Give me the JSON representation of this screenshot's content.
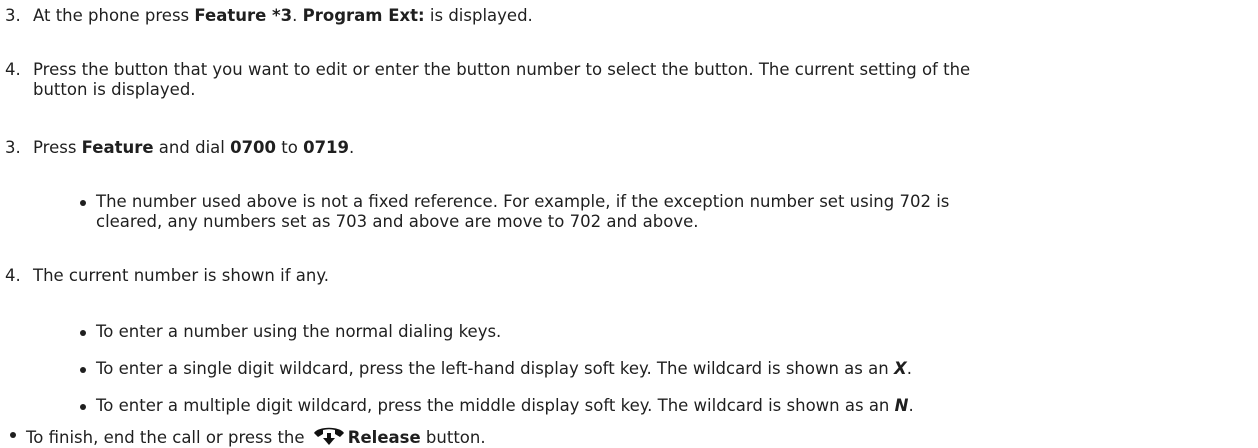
{
  "steps": [
    {
      "num": "3.",
      "prefix": "At the phone press ",
      "bold1": "Feature *3",
      "mid": ". ",
      "bold2": "Program Ext:",
      "suffix": " is displayed."
    },
    {
      "num": "4.",
      "line1": "Press the button that you want to edit or enter the button number to select the button. The current setting of the",
      "line2": "button is displayed."
    },
    {
      "num": "3.",
      "prefix": "Press ",
      "bold1": "Feature",
      "mid": " and dial ",
      "bold2": "0700",
      "mid2": " to ",
      "bold3": "0719",
      "suffix": "."
    },
    {
      "num": "4.",
      "text": "The current number is shown if any."
    }
  ],
  "bullet_exception": {
    "line1": "The number used above is not a fixed reference. For example, if the exception number set using 702 is",
    "line2": "cleared, any numbers set as 703 and above are move to 702 and above."
  },
  "bullets_number": [
    {
      "text": "To enter a number using the normal dialing keys."
    },
    {
      "prefix": "To enter a single digit wildcard, press the left-hand display soft key. The wildcard is shown as an ",
      "emph": "X",
      "suffix": "."
    },
    {
      "prefix": "To enter a multiple digit wildcard, press the middle display soft key. The wildcard is shown as an ",
      "emph": "N",
      "suffix": "."
    }
  ],
  "finish": {
    "prefix": "To finish, end the call or press the ",
    "icon": "phone-release-icon",
    "bold": "Release",
    "suffix": " button."
  }
}
